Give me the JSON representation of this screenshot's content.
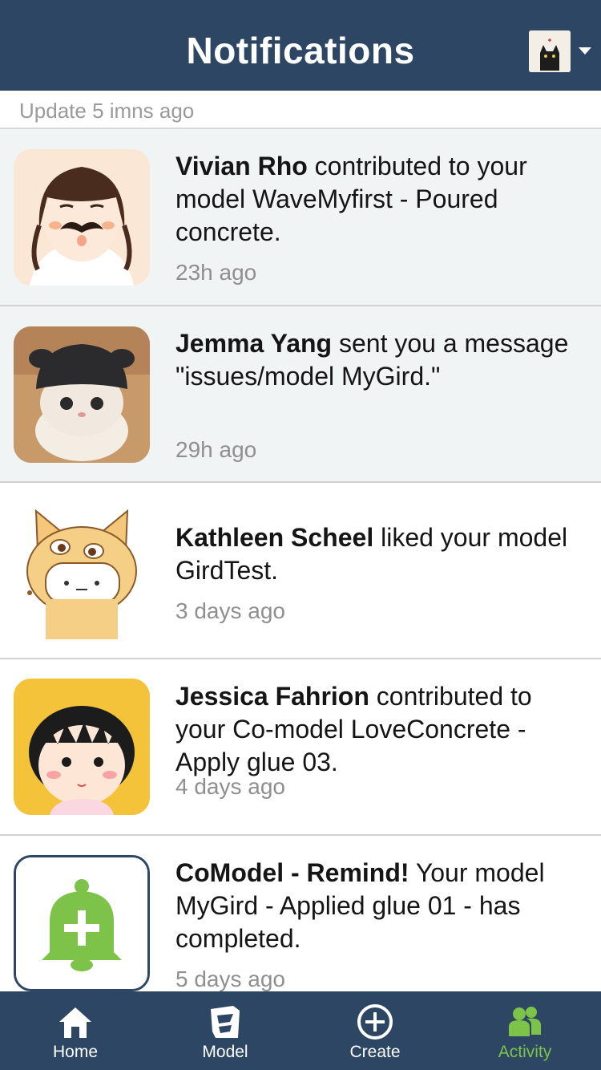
{
  "header": {
    "title": "Notifications",
    "avatar_icon": "black-cat-avatar",
    "dropdown_icon": "caret-down-icon"
  },
  "update_status": "Update 5 imns ago",
  "notifications": [
    {
      "name": "Vivian Rho",
      "message": " contributed to your model WaveMyfirst - Poured concrete.",
      "time": "23h ago",
      "avatar": "girl-mustache-avatar",
      "unread": true
    },
    {
      "name": "Jemma Yang",
      "message": " sent you a message \"issues/model MyGird.\"",
      "time": "29h ago",
      "avatar": "cat-in-hat-avatar",
      "unread": true
    },
    {
      "name": "Kathleen Scheel",
      "message": " liked your model GirdTest.",
      "time": "3 days ago",
      "avatar": "shiba-dog-avatar",
      "unread": false
    },
    {
      "name": "Jessica Fahrion",
      "message": " contributed to your Co-model LoveConcrete - Apply glue 03.",
      "time": "4 days ago",
      "avatar": "cartoon-girl-avatar",
      "unread": false
    },
    {
      "name": "CoModel - Remind!",
      "message": " Your model MyGird - Applied glue 01 - has completed.",
      "time": "5 days ago",
      "avatar": "bell-plus-icon",
      "unread": false
    }
  ],
  "tabs": [
    {
      "label": "Home",
      "icon": "home-icon",
      "active": false
    },
    {
      "label": "Model",
      "icon": "model-icon",
      "active": false
    },
    {
      "label": "Create",
      "icon": "plus-circle-icon",
      "active": false
    },
    {
      "label": "Activity",
      "icon": "activity-icon",
      "active": true
    }
  ],
  "colors": {
    "header_bg": "#2c4664",
    "active_tab": "#7dc349",
    "unread_bg": "#f1f4f5",
    "bell_green": "#7dc349"
  }
}
